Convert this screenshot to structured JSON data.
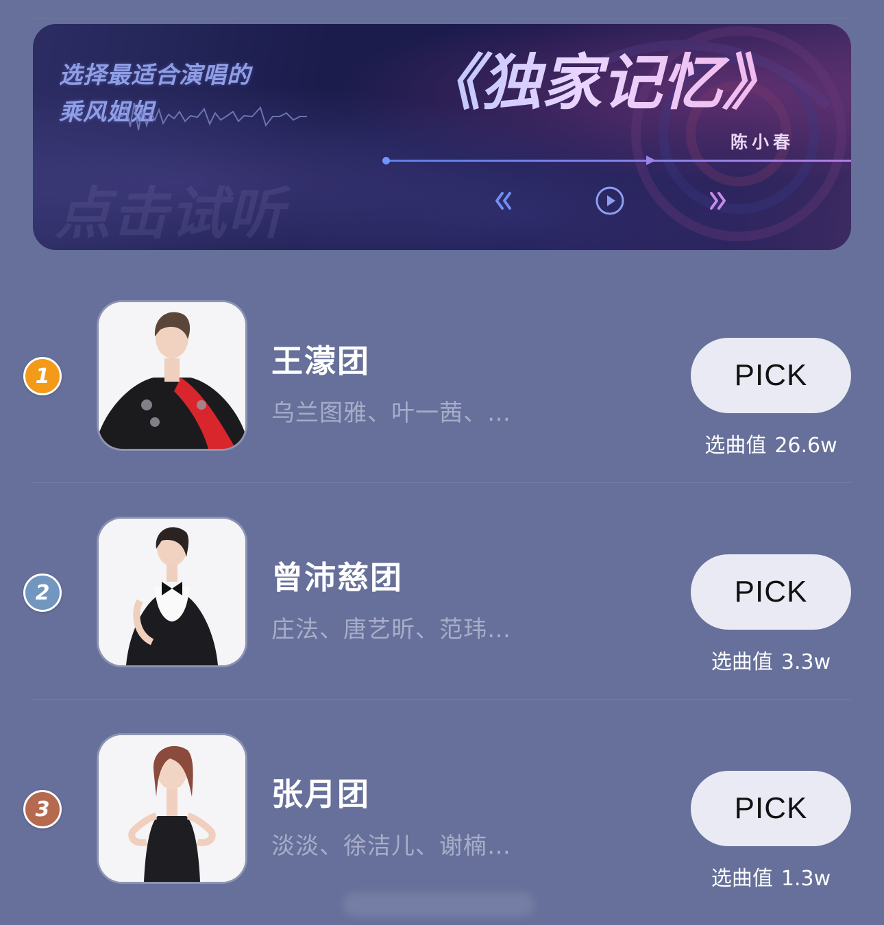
{
  "banner": {
    "tagline_line1": "选择最适合演唱的",
    "tagline_line2": "乘风姐姐",
    "hint": "点击试听",
    "song_title": "《独家记忆》",
    "singer": "陈小春",
    "playback_progress": 0.58
  },
  "list": {
    "items": [
      {
        "rank": "1",
        "group_name": "王濛团",
        "members": "乌兰图雅、叶一茜、…",
        "pick_label": "PICK",
        "score_label": "选曲值",
        "score_value": "26.6w",
        "badge_color": "#f39a19"
      },
      {
        "rank": "2",
        "group_name": "曾沛慈团",
        "members": "庄法、唐艺昕、范玮…",
        "pick_label": "PICK",
        "score_label": "选曲值",
        "score_value": "3.3w",
        "badge_color": "#7196bf"
      },
      {
        "rank": "3",
        "group_name": "张月团",
        "members": "淡淡、徐洁儿、谢楠…",
        "pick_label": "PICK",
        "score_label": "选曲值",
        "score_value": "1.3w",
        "badge_color": "#b56a4f"
      }
    ]
  },
  "colors": {
    "page_background": "#66709a",
    "pick_button": "#e9eaf4",
    "song_title_gradient_start": "#b8c4ff",
    "song_title_gradient_end": "#f3b6ea"
  },
  "icons": {
    "prev": "double-chevron-left-icon",
    "play": "play-circle-icon",
    "next": "double-chevron-right-icon"
  }
}
